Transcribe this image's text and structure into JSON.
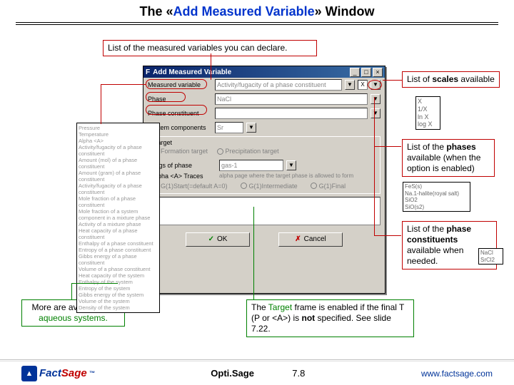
{
  "title": {
    "pre": "The «",
    "main": "Add Measured Variable",
    "post": "» Window"
  },
  "callouts": {
    "measured_vars": "List of the measured variables you can declare.",
    "scales": "List of scales available",
    "phases": "List of the phases available (when the option is enabled)",
    "constituents": "List of the phase constituents available when needed.",
    "aqueous1": "More are available for",
    "aqueous2": "aqueous systems.",
    "target1": "The Target frame is enabled if the",
    "target2": "final T (P or <A>) is not specified.",
    "target3": "See slide 7.22."
  },
  "dialog": {
    "title": "Add Measured Variable",
    "labels": {
      "measured": "Measured variable",
      "phase": "Phase",
      "phconst": "Phase constituent",
      "syscomp": "System components",
      "target": "Target",
      "tagsphase": "Tags of phase",
      "alpha": "Alpha <A> Traces"
    },
    "fields": {
      "measured": "Activity/fugacity of a phase constituent",
      "phase": "NaCl",
      "gas": "gas-1"
    },
    "radios": {
      "formation": "Formation target",
      "precip": "Precipitation target"
    },
    "buttons": {
      "ok": "OK",
      "cancel": "Cancel"
    }
  },
  "lists": {
    "measured": "Pressure\nTemperature\nAlpha <A>\nActivity/fugacity of a phase constituent\nAmount (mol) of a phase constituent\nAmount (gram) of a phase constituent\nActivity/fugacity of a phase constituent\nMole fraction of a phase constituent\nMole fraction of a system component in a mixture phase\nActivity of a mixture phase\nHeat capacity of a phase constituent\nEnthalpy of a phase constituent\nEntropy of a phase constituent\nGibbs energy of a phase constituent\nVolume of a phase constituent\nHeat capacity of the system\nEnthalpy of the system\nEntropy of the system\nGibbs energy of the system\nVolume of the system\nDensity of the system",
    "scales": "X\n1/X\nln X\nlog X",
    "phases": "FeS(s)\nNa.1-halite(royal salt)\nSiO2\nSiO(s2)",
    "const": "NaCl\nSrCl2"
  },
  "footer": {
    "logo1": "Fact",
    "logo2": "Sage",
    "center": "Opti.Sage",
    "page": "7.8",
    "url": "www.factsage.com"
  }
}
